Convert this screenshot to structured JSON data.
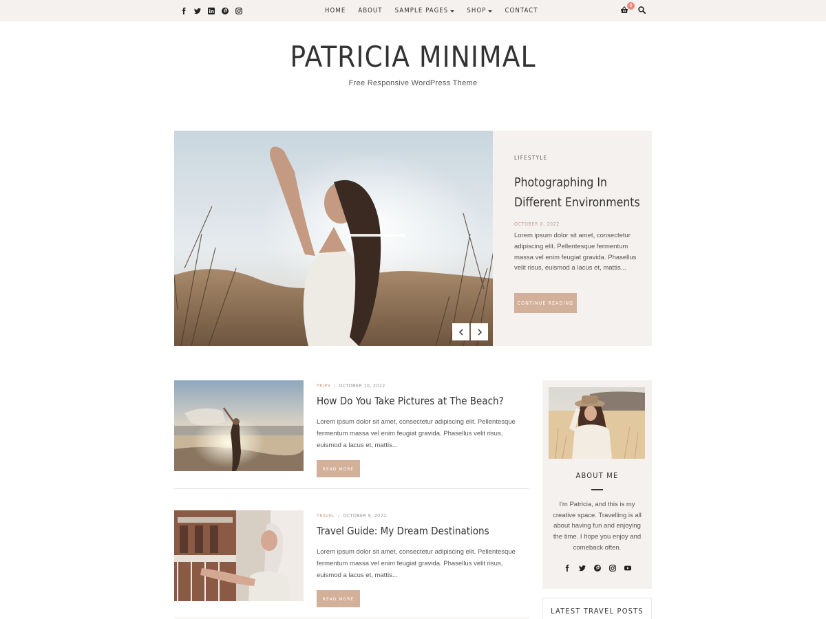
{
  "topbar": {
    "social_icons": [
      "facebook-icon",
      "twitter-icon",
      "linkedin-icon",
      "pinterest-icon",
      "instagram-icon"
    ],
    "nav": [
      {
        "label": "HOME",
        "dropdown": false
      },
      {
        "label": "ABOUT",
        "dropdown": false
      },
      {
        "label": "SAMPLE PAGES",
        "dropdown": true
      },
      {
        "label": "SHOP",
        "dropdown": true
      },
      {
        "label": "CONTACT",
        "dropdown": false
      }
    ],
    "cart_count": "0",
    "cart_icon": "basket-icon",
    "search_icon": "search-icon"
  },
  "header": {
    "title": "PATRICIA MINIMAL",
    "tagline": "Free Responsive WordPress Theme"
  },
  "hero": {
    "category": "LIFESTYLE",
    "title": "Photographing In Different Environments",
    "date": "OCTOBER 8, 2022",
    "excerpt": "Lorem ipsum dolor sit amet, consectetur adipiscing elit. Pellentesque fermentum massa vel enim feugiat gravida. Phasellus velit risus, euismod a lacus et, mattis...",
    "button": "CONTINUE READING",
    "prev_icon": "chevron-left-icon",
    "next_icon": "chevron-right-icon"
  },
  "posts": [
    {
      "category": "TRIPS",
      "date": "OCTOBER 10, 2022",
      "title": "How Do You Take Pictures at The Beach?",
      "excerpt": "Lorem ipsum dolor sit amet, consectetur adipiscing elit. Pellentesque fermentum massa vel enim feugiat gravida. Phasellus velit risus, euismod a lacus et, mattis...",
      "button": "READ MORE"
    },
    {
      "category": "TRAVEL",
      "date": "OCTOBER 9, 2022",
      "title": "Travel Guide: My Dream Destinations",
      "excerpt": "Lorem ipsum dolor sit amet, consectetur adipiscing elit. Pellentesque fermentum massa vel enim feugiat gravida. Phasellus velit risus, euismod a lacus et, mattis...",
      "button": "READ MORE"
    }
  ],
  "sidebar": {
    "about_heading": "ABOUT ME",
    "about_text": "I'm Patricia, and this is my creative space. Travelling is all about having fun and enjoying the time. I hope you enjoy and comeback often.",
    "social_icons": [
      "facebook-icon",
      "twitter-icon",
      "pinterest-icon",
      "instagram-icon",
      "youtube-icon"
    ],
    "latest_heading": "LATEST TRAVEL POSTS"
  },
  "colors": {
    "topbar_bg": "#f5f1ee",
    "panel_bg": "#f5f1ee",
    "accent": "#d3b09a",
    "meta_accent": "#c4a38c",
    "badge": "#e8897d",
    "text": "#333333"
  }
}
